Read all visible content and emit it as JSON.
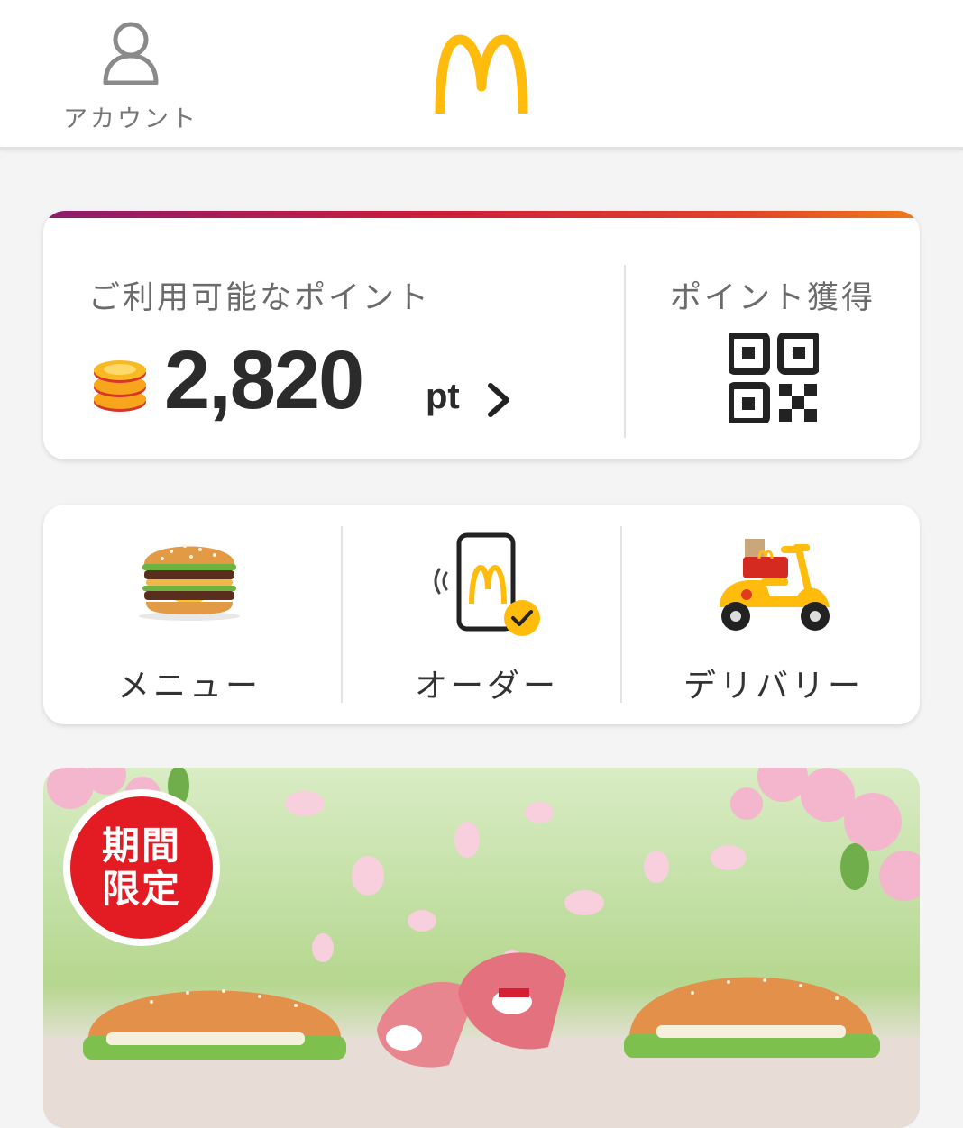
{
  "header": {
    "account_label": "アカウント"
  },
  "points": {
    "caption": "ご利用可能なポイント",
    "value": "2,820",
    "unit": "pt",
    "earn_label": "ポイント獲得"
  },
  "nav": {
    "items": [
      {
        "label": "メニュー",
        "icon": "burger-icon"
      },
      {
        "label": "オーダー",
        "icon": "mobile-order-icon"
      },
      {
        "label": "デリバリー",
        "icon": "delivery-scooter-icon"
      }
    ]
  },
  "promo": {
    "badge_line1": "期間",
    "badge_line2": "限定"
  },
  "colors": {
    "brand_yellow": "#ffbc0d",
    "brand_red": "#e31c23",
    "background": "#f4f4f4"
  }
}
